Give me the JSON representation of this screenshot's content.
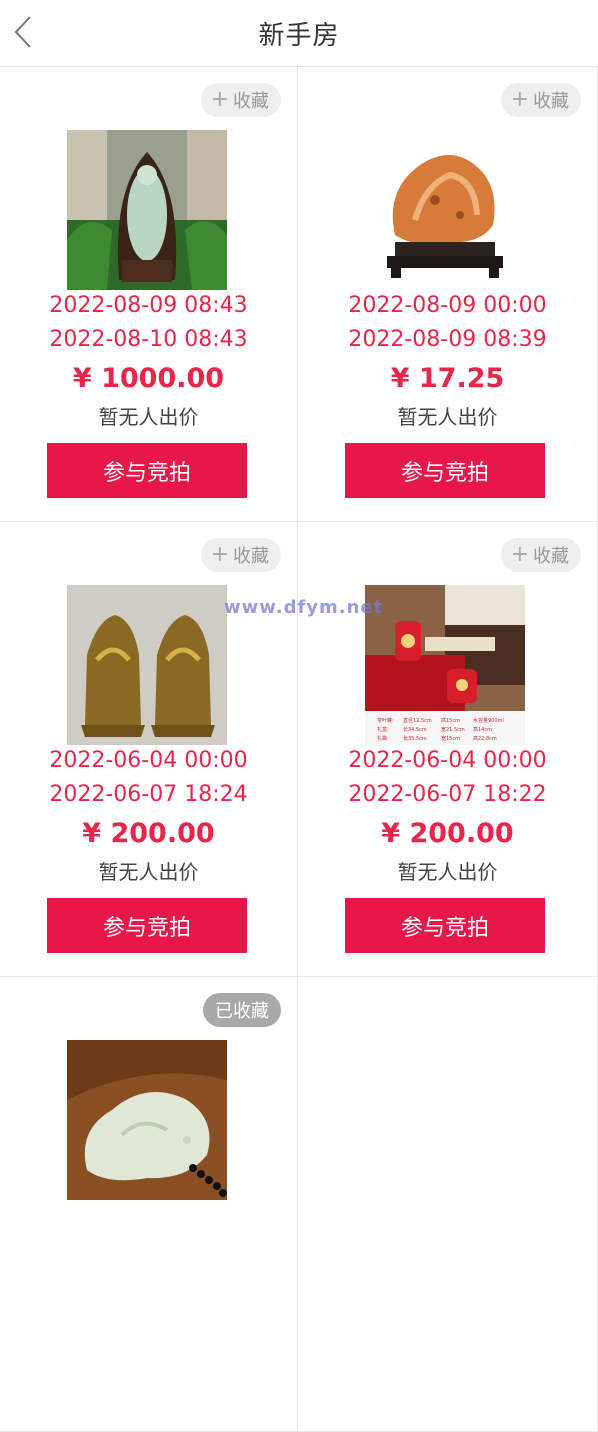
{
  "header": {
    "title": "新手房"
  },
  "labels": {
    "fav": "收藏",
    "bid": "参与竞拍",
    "no_bid": "暂无人出价"
  },
  "items": [
    {
      "start": "2022-08-09 08:43",
      "end": "2022-08-10 08:43",
      "price": "¥ 1000.00",
      "fav_label": "收藏"
    },
    {
      "start": "2022-08-09 00:00",
      "end": "2022-08-09 08:39",
      "price": "¥ 17.25",
      "fav_label": "收藏"
    },
    {
      "start": "2022-06-04 00:00",
      "end": "2022-06-07 18:24",
      "price": "¥ 200.00",
      "fav_label": "收藏"
    },
    {
      "start": "2022-06-04 00:00",
      "end": "2022-06-07 18:22",
      "price": "¥ 200.00",
      "fav_label": "收藏"
    },
    {
      "fav_label": "已收藏"
    }
  ],
  "item4_caption": {
    "r1": [
      "茶叶罐:",
      "直径12.5cm",
      "高15cm",
      "水容量900ml"
    ],
    "r2": [
      "礼盒:",
      "长34.5cm",
      "宽21.5cm",
      "高14cm"
    ],
    "r3": [
      "礼袋:",
      "长35.5cm",
      "宽15cm",
      "高22.8cm"
    ]
  },
  "watermark": "www.dfym.net",
  "colors": {
    "accent": "#e8174a",
    "price": "#e8264b"
  }
}
